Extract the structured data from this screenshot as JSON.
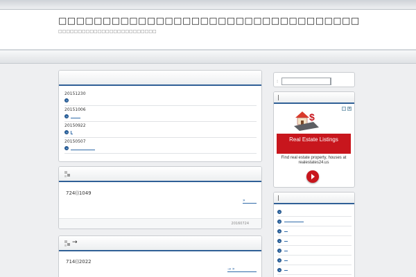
{
  "header": {
    "site_title": "□□□□□□□□□□□□□□□□□□□□□□□□□□□□□□□□□□",
    "site_description": "□□□□□□□□□□□□□□□□□□□□□□□□□"
  },
  "news": {
    "items": [
      {
        "date": "20151230"
      },
      {
        "date": "20151006"
      },
      {
        "date": "20150922"
      },
      {
        "date": "20150507"
      }
    ]
  },
  "posts": [
    {
      "title_symbol": "",
      "text": "724()1049",
      "more": "»",
      "date": "20160724"
    },
    {
      "title_symbol": "→",
      "text": "714()2022",
      "more": "→ »"
    }
  ],
  "sidebar": {
    "search_label": ":",
    "ad": {
      "headline": "Real Estate Listings",
      "body": "Find real estate property, houses at realestates24.us",
      "close": "×",
      "colors": {
        "brand": "#c8161d"
      }
    },
    "link_count_visible": 8
  },
  "colors": {
    "accent": "#2f5f96",
    "link": "#2f6aa8"
  }
}
